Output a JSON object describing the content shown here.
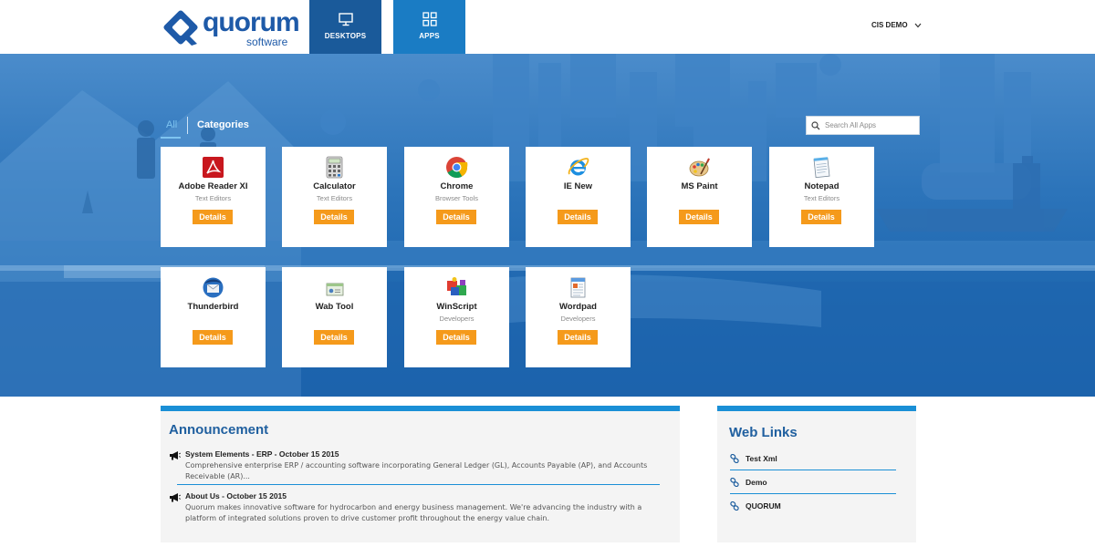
{
  "header": {
    "logo_text": "quorum",
    "logo_sub": "software",
    "tabs": [
      {
        "label": "DESKTOPS",
        "icon": "monitor-icon"
      },
      {
        "label": "APPS",
        "icon": "grid-icon"
      }
    ],
    "user": "CIS DEMO"
  },
  "filters": {
    "all": "All",
    "categories": "Categories"
  },
  "search": {
    "placeholder": "Search All Apps"
  },
  "apps": [
    {
      "name": "Adobe Reader XI",
      "category": "Text Editors",
      "details": "Details",
      "icon": "adobe-reader-icon"
    },
    {
      "name": "Calculator",
      "category": "Text Editors",
      "details": "Details",
      "icon": "calculator-icon"
    },
    {
      "name": "Chrome",
      "category": "Browser Tools",
      "details": "Details",
      "icon": "chrome-icon"
    },
    {
      "name": "IE New",
      "category": "",
      "details": "Details",
      "icon": "internet-explorer-icon"
    },
    {
      "name": "MS Paint",
      "category": "",
      "details": "Details",
      "icon": "paint-palette-icon"
    },
    {
      "name": "Notepad",
      "category": "Text Editors",
      "details": "Details",
      "icon": "notepad-icon"
    },
    {
      "name": "Thunderbird",
      "category": "",
      "details": "Details",
      "icon": "thunderbird-icon"
    },
    {
      "name": "Wab Tool",
      "category": "",
      "details": "Details",
      "icon": "wab-tool-icon"
    },
    {
      "name": "WinScript",
      "category": "Developers",
      "details": "Details",
      "icon": "winscript-icon"
    },
    {
      "name": "Wordpad",
      "category": "Developers",
      "details": "Details",
      "icon": "wordpad-icon"
    }
  ],
  "announcement": {
    "title": "Announcement",
    "items": [
      {
        "heading": "System Elements - ERP - October 15 2015",
        "body": "Comprehensive enterprise ERP / accounting software incorporating General Ledger (GL), Accounts Payable (AP), and Accounts Receivable (AR)..."
      },
      {
        "heading": "About Us - October 15 2015",
        "body": "Quorum makes innovative software for hydrocarbon and energy business management. We're advancing the industry with a platform of integrated solutions proven to drive customer profit throughout the energy value chain."
      }
    ]
  },
  "weblinks": {
    "title": "Web Links",
    "items": [
      "Test Xml",
      "Demo",
      "QUORUM"
    ]
  },
  "colors": {
    "brand_blue": "#1e5aa8",
    "hero_blue": "#2c74ba",
    "accent_orange": "#f59a1b",
    "panel_bar": "#1a8fd6"
  }
}
